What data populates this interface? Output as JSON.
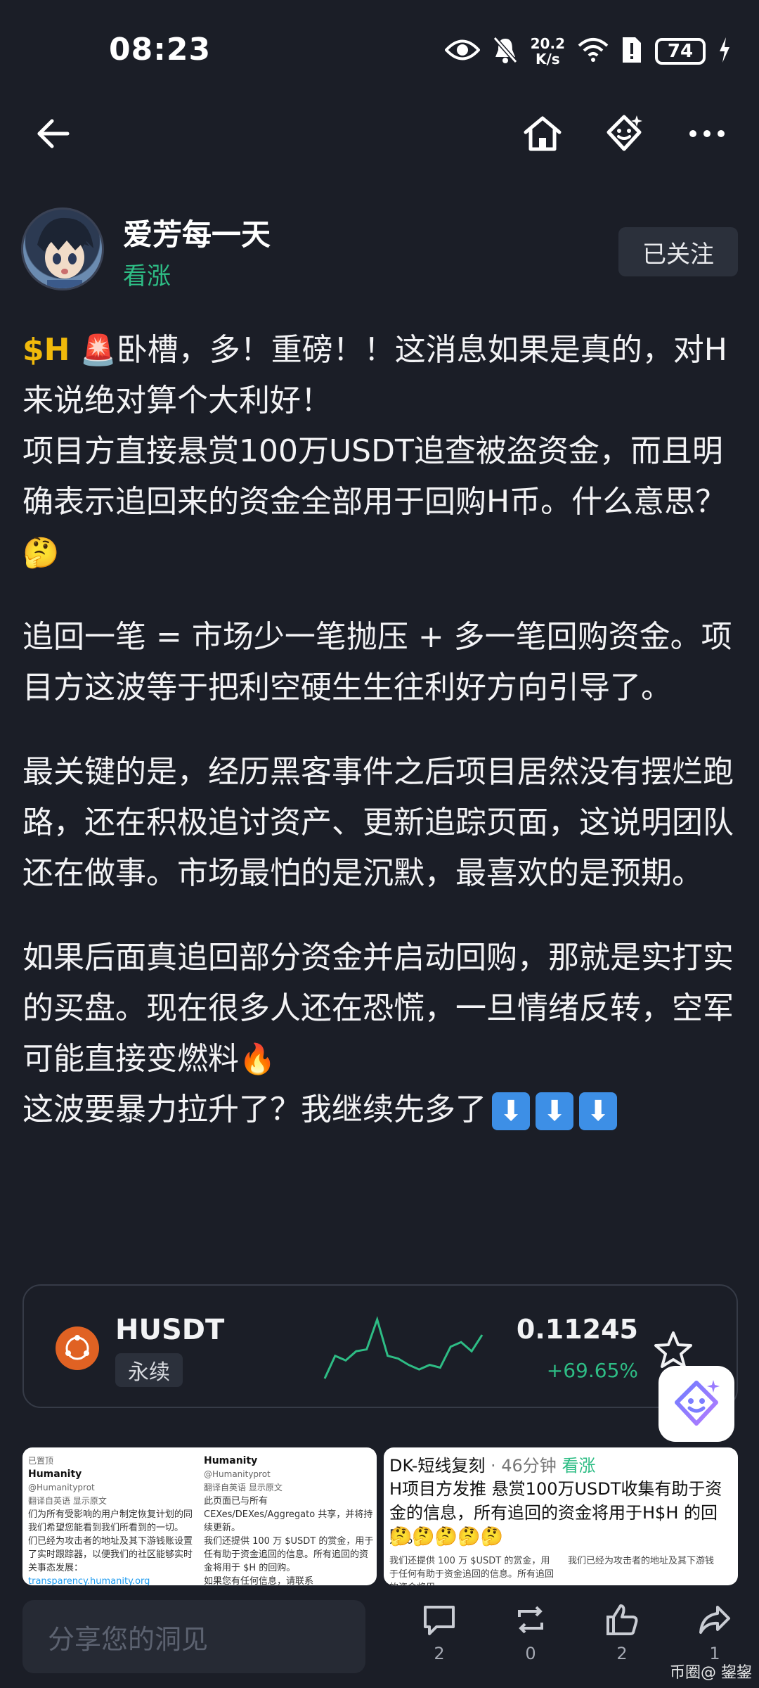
{
  "status_bar": {
    "time": "08:23",
    "net_speed_value": "20.2",
    "net_speed_unit": "K/s",
    "battery": "74",
    "icons": [
      "eye-icon",
      "mute-bell-icon",
      "wifi-icon",
      "sim-alert-icon",
      "battery-icon",
      "charging-icon"
    ]
  },
  "topbar": {
    "icons": [
      "back-arrow-icon",
      "home-icon",
      "ai-assistant-icon",
      "more-icon"
    ]
  },
  "author": {
    "name": "爱芳每一天",
    "tag": "看涨",
    "follow_label": "已关注"
  },
  "post": {
    "ticker": "$H",
    "p1_rest": "卧槽，多！重磅！！这消息如果是真的，对H来说绝对算个大利好！",
    "p1_line2": "项目方直接悬赏100万USDT追查被盗资金，而且明确表示追回来的资金全部用于回购H币。什么意思？",
    "p2": "追回一笔 = 市场少一笔抛压 + 多一笔回购资金。项目方这波等于把利空硬生生往利好方向引导了。",
    "p3": "最关键的是，经历黑客事件之后项目居然没有摆烂跑路，还在积极追讨资产、更新追踪页面，这说明团队还在做事。市场最怕的是沉默，最喜欢的是预期。",
    "p4_a": "如果后面真追回部分资金并启动回购，那就是实打实的买盘。现在很多人还在恐慌，一旦情绪反转，空军可能直接变燃料",
    "p4_b": "这波要暴力拉升了？我继续先多了",
    "emoji_siren": "🚨",
    "emoji_think": "🤔",
    "emoji_fire": "🔥",
    "arrow_glyph": "⬇"
  },
  "market_card": {
    "symbol": "HUSDT",
    "badge": "永续",
    "price": "0.11245",
    "change": "+69.65%",
    "change_color": "#2ebd85"
  },
  "attachments": {
    "a1_col1": {
      "pinned": "已置顶",
      "name": "Humanity",
      "handle": "@Humanityprot",
      "translate": "翻译自英语  显示原文",
      "text": "们为所有受影响的用户制定恢复计划的同我们希望您能看到我们所看到的一切。",
      "text2": "们已经为攻击者的地址及其下游钱账设置了实时跟踪器，以便我们的社区能够实时关事态发展：",
      "link": "transparency.humanity.org"
    },
    "a1_col2": {
      "name": "Humanity",
      "handle": "@Humanityprot",
      "translate": "翻译自英语  显示原文",
      "text": "此页面已与所有 CEXes/DEXes/Aggregato 共享，并将持续更新。",
      "text2": "我们还提供 100 万 $USDT 的赏金，用于任有助于资金追回的信息。所有追回的资金将用于 $H 的回购。",
      "text3": "如果您有任何信息，请联系"
    },
    "a2": {
      "author": "DK-短线复刻",
      "time": "46分钟",
      "tag": "看涨",
      "body": "H项目方发推 悬赏100万USDT收集有助于资金的信息，所有追回的资金将用于H$H 的回购。",
      "emojis": "🤔🤔🤔🤔🤔",
      "sub1": "我们还提供 100 万 $USDT 的赏金，用于任何有助于资金追回的信息。所有追回的资金将用",
      "sub2": "我们已经为攻击者的地址及其下游钱"
    }
  },
  "bottom_bar": {
    "placeholder": "分享您的洞见",
    "comment_count": "2",
    "repost_count": "0",
    "like_count": "2",
    "share_count": "1",
    "watermark": "币圈@ 鋆鋆"
  },
  "chart_data": {
    "type": "line",
    "title": "",
    "series": [
      {
        "values": [
          0.3,
          0.55,
          0.5,
          0.6,
          0.62,
          0.95,
          0.55,
          0.52,
          0.45,
          0.4,
          0.45,
          0.42,
          0.65,
          0.7,
          0.6,
          0.78
        ]
      }
    ]
  }
}
